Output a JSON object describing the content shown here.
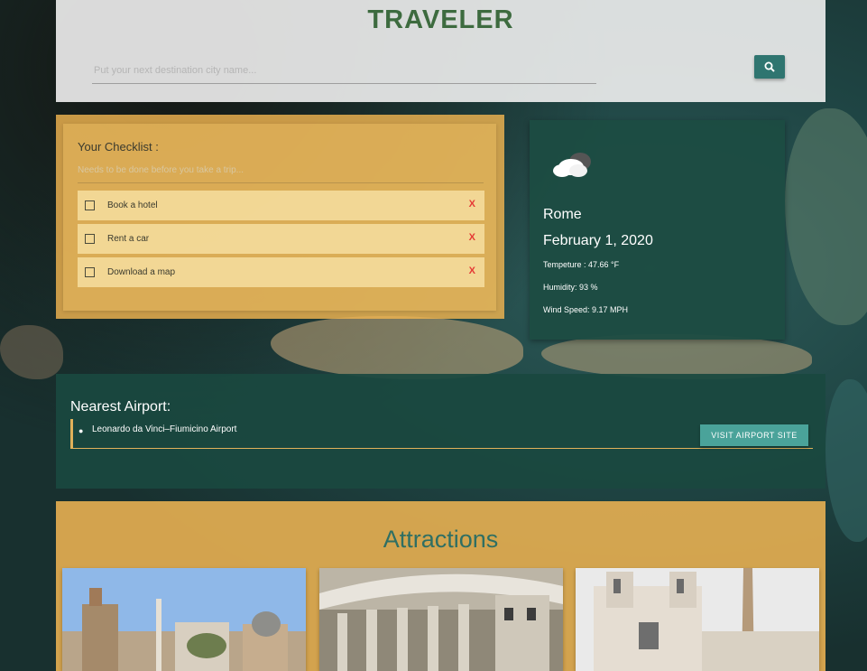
{
  "header": {
    "title": "TRAVELER",
    "search_placeholder": "Put your next destination city name..."
  },
  "checklist": {
    "title": "Your Checklist :",
    "subtitle": "Needs to be done before you take a trip...",
    "remove_label": "X",
    "items": [
      {
        "label": "Book a hotel"
      },
      {
        "label": "Rent a car"
      },
      {
        "label": "Download a map"
      }
    ]
  },
  "weather": {
    "icon": "cloudy-icon",
    "city": "Rome",
    "date": "February 1, 2020",
    "temperature": "Tempeture : 47.66 °F",
    "humidity": "Humidity: 93 %",
    "wind": "Wind Speed: 9.17 MPH"
  },
  "airport": {
    "title": "Nearest Airport:",
    "name": "Leonardo da Vinci–Fiumicino Airport",
    "button_label": "VISIT AIRPORT SITE"
  },
  "attractions": {
    "title": "Attractions"
  },
  "colors": {
    "accent_green": "#2f7570",
    "panel_green": "#1c4c42",
    "panel_orange": "#f0b450",
    "remove_red": "#e53935"
  }
}
